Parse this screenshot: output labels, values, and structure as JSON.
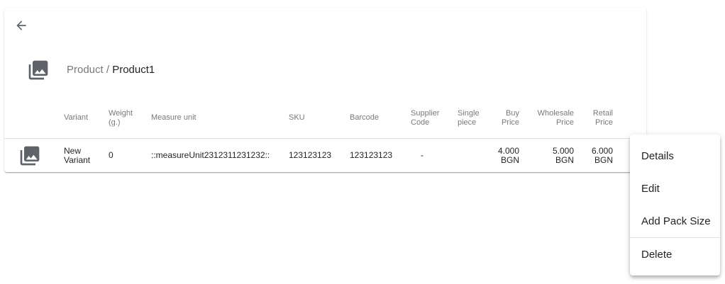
{
  "header": {
    "back_icon": "arrow-back-icon",
    "product_image_icon": "photo-library-icon",
    "breadcrumb": {
      "parent": "Product",
      "separator": " / ",
      "current": "Product1"
    }
  },
  "table": {
    "columns": [
      {
        "key": "variant",
        "label": "Variant"
      },
      {
        "key": "weight",
        "label": "Weight\n(g.)"
      },
      {
        "key": "measure_unit",
        "label": "Measure unit"
      },
      {
        "key": "sku",
        "label": "SKU"
      },
      {
        "key": "barcode",
        "label": "Barcode"
      },
      {
        "key": "supplier_code",
        "label": "Supplier\nCode"
      },
      {
        "key": "single_piece",
        "label": "Single\npiece"
      },
      {
        "key": "buy_price",
        "label": "Buy\nPrice"
      },
      {
        "key": "wholesale_price",
        "label": "Wholesale\nPrice"
      },
      {
        "key": "retail_price",
        "label": "Retail\nPrice"
      }
    ],
    "rows": [
      {
        "image_icon": "photo-library-icon",
        "variant": "New\nVariant",
        "weight": "0",
        "measure_unit": "::measureUnit2312311231232::",
        "sku": "123123123",
        "barcode": "123123123",
        "supplier_code": "-",
        "single_piece": "",
        "buy_price": "4.000\nBGN",
        "wholesale_price": "5.000\nBGN",
        "retail_price": "6.000\nBGN"
      }
    ]
  },
  "context_menu": {
    "items": [
      {
        "label": "Details"
      },
      {
        "label": "Edit"
      },
      {
        "label": "Add Pack Size"
      },
      {
        "label": "Delete"
      }
    ]
  },
  "colors": {
    "icon": "#5f6368",
    "divider": "#e0e0e0"
  }
}
